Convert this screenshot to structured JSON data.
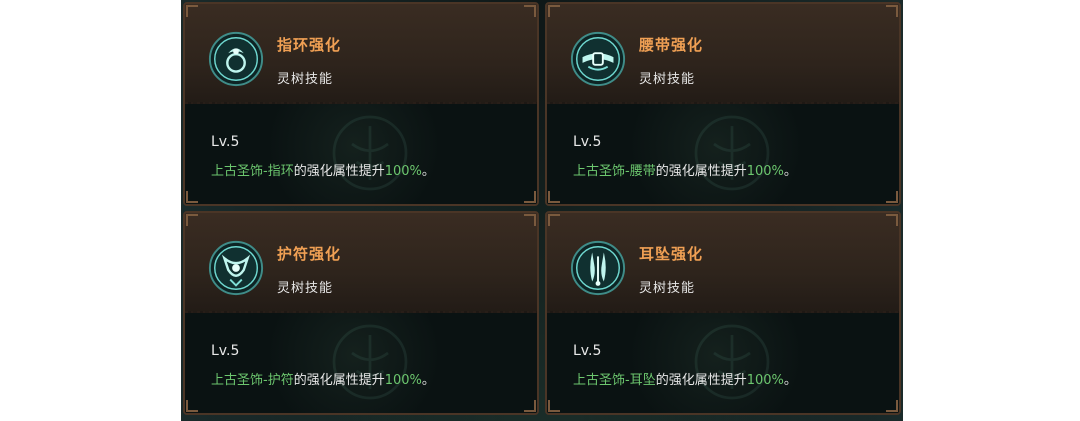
{
  "cards": [
    {
      "title": "指环强化",
      "subtitle": "灵树技能",
      "level": "Lv.5",
      "desc_item": "上古圣饰-指环",
      "desc_mid": "的强化属性提升",
      "desc_value": "100%",
      "desc_end": "。",
      "icon": "ring-icon"
    },
    {
      "title": "腰带强化",
      "subtitle": "灵树技能",
      "level": "Lv.5",
      "desc_item": "上古圣饰-腰带",
      "desc_mid": "的强化属性提升",
      "desc_value": "100%",
      "desc_end": "。",
      "icon": "belt-icon"
    },
    {
      "title": "护符强化",
      "subtitle": "灵树技能",
      "level": "Lv.5",
      "desc_item": "上古圣饰-护符",
      "desc_mid": "的强化属性提升",
      "desc_value": "100%",
      "desc_end": "。",
      "icon": "amulet-icon"
    },
    {
      "title": "耳坠强化",
      "subtitle": "灵树技能",
      "level": "Lv.5",
      "desc_item": "上古圣饰-耳坠",
      "desc_mid": "的强化属性提升",
      "desc_value": "100%",
      "desc_end": "。",
      "icon": "earring-icon"
    }
  ],
  "colors": {
    "title": "#f0a054",
    "highlight": "#6cc66e",
    "icon_glow": "#7fe0d8"
  }
}
